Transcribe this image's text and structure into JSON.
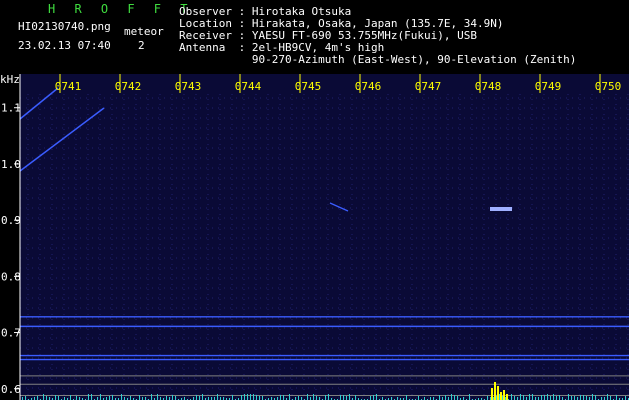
{
  "header": {
    "app_name": "H R O F F T",
    "filename": "HI02130740.png",
    "timestamp": "23.02.13 07:40",
    "meteor_label": "meteor",
    "meteor_count": "2"
  },
  "station": {
    "observer_line": "Observer : Hirotaka Otsuka",
    "location_line": "Location : Hirakata, Osaka, Japan (135.7E, 34.9N)",
    "receiver_line": "Receiver : YAESU FT-690 53.755MHz(Fukui), USB",
    "antenna_line": "Antenna  : 2el-HB9CV, 4m's high",
    "antenna_line2": "           90-270-Azimuth (East-West), 90-Elevation (Zenith)"
  },
  "spectrogram": {
    "unit_label": "kHz",
    "time_ticks": [
      "0741",
      "0742",
      "0743",
      "0744",
      "0745",
      "0746",
      "0747",
      "0748",
      "0749",
      "0750"
    ],
    "freq_ticks": [
      "1.1",
      "1.0",
      "0.9",
      "0.8",
      "0.7",
      "0.6"
    ],
    "freq_range": [
      0.58,
      1.16
    ],
    "colors": {
      "background": "#0a0a36",
      "grid": "#202070",
      "signal": "#3a5cff",
      "echo": "#9fb0ff",
      "tick_text": "#ffff00",
      "freq_text": "#ffffff",
      "reference_line": "#808080",
      "audio_bars": "#30d0d0",
      "audio_peak": "#ffff00"
    }
  }
}
